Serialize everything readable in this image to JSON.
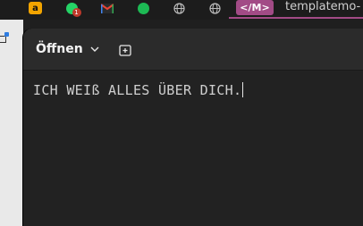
{
  "browser_tabs": {
    "amazon_glyph": "a",
    "whatsapp_badge": "1",
    "tm_badge": "</M>",
    "active_tab_title": "templatemo-"
  },
  "editor_window": {
    "open_label": "Öffnen",
    "content": "ICH WEIß ALLES ÜBER DICH."
  },
  "colors": {
    "accent": "#a24b86",
    "window_bg": "#222222",
    "header_bg": "#2b2b2b"
  }
}
